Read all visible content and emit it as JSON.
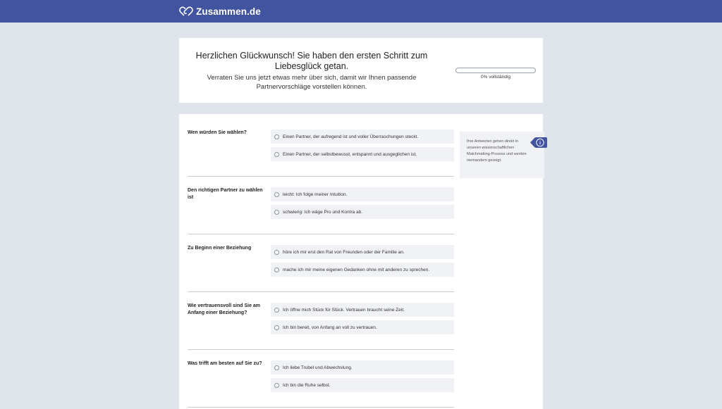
{
  "header": {
    "brand": "Zusammen.de"
  },
  "intro": {
    "title": "Herzlichen Glückwunsch! Sie haben den ersten Schritt zum Liebesglück getan.",
    "subtitle": "Verraten Sie uns jetzt etwas mehr über sich, damit wir Ihnen passende Partnervorschläge vorstellen können.",
    "progress_percent": 0,
    "progress_label": "0% vollständig"
  },
  "questions": [
    {
      "label": "Wen würden Sie wählen?",
      "options": [
        "Einen Partner, der aufregend ist und voller Überraschungen steckt.",
        "Einen Partner, der selbstbewusst, entspannt und ausgeglichen ist."
      ]
    },
    {
      "label": "Den richtigen Partner zu wählen ist",
      "options": [
        "leicht: Ich folge meiner Intuition.",
        "schwierig: Ich wäge Pro und Kontra ab."
      ]
    },
    {
      "label": "Zu Beginn einer Beziehung",
      "options": [
        "höre ich mir erst den Rat von Freunden oder der Familie an.",
        "mache ich mir meine eigenen Gedanken ohne mit anderen zu sprechen."
      ]
    },
    {
      "label": "Wie vertrauensvoll sind Sie am Anfang einer Beziehung?",
      "options": [
        "Ich öffne mich Stück für Stück. Vertrauen braucht seine Zeit.",
        "Ich bin bereit, von Anfang an voll zu vertrauen."
      ]
    },
    {
      "label": "Was trifft am besten auf Sie zu?",
      "options": [
        "Ich liebe Trubel und Abwechslung.",
        "Ich bin die Ruhe selbst."
      ]
    }
  ],
  "info": {
    "text": "Ihre Antworten gehen direkt in unseren wissenschaftlichen Matchmaking-Prozess und werden niemandem gezeigt.",
    "icon": "info-icon"
  },
  "colors": {
    "brand": "#4253a0",
    "background": "#dfe3ea",
    "option_bg": "#f1f2f6"
  }
}
